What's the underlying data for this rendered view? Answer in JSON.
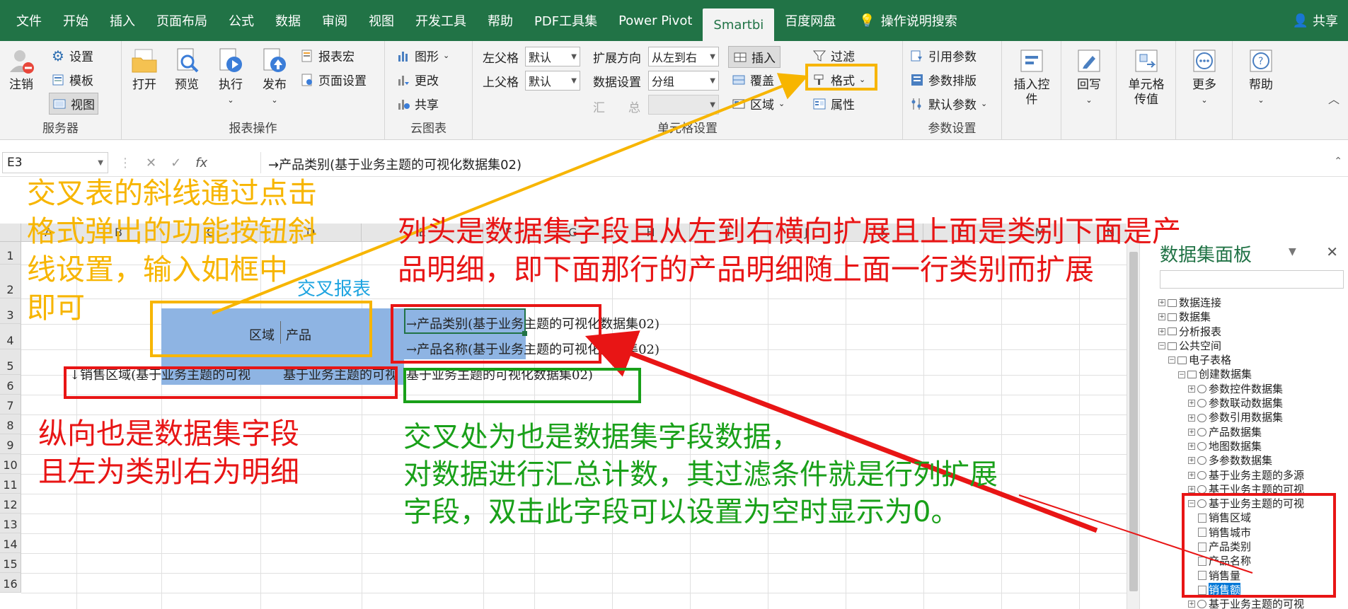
{
  "menu": {
    "tabs": [
      "文件",
      "开始",
      "插入",
      "页面布局",
      "公式",
      "数据",
      "审阅",
      "视图",
      "开发工具",
      "帮助",
      "PDF工具集",
      "Power Pivot",
      "Smartbi",
      "百度网盘"
    ],
    "active_tab": "Smartbi",
    "tell_me": "操作说明搜索",
    "share": "共享"
  },
  "ribbon": {
    "server": {
      "logout": "注销",
      "settings": "设置",
      "template": "模板",
      "view": "视图",
      "label": "服务器"
    },
    "report_ops": {
      "open": "打开",
      "preview": "预览",
      "execute": "执行",
      "publish": "发布",
      "macro": "报表宏",
      "page_setup": "页面设置",
      "label": "报表操作"
    },
    "cloud_chart": {
      "chart": "图形",
      "change": "更改",
      "share": "共享",
      "label": "云图表"
    },
    "cell_settings": {
      "left_parent": "左父格",
      "left_parent_value": "默认",
      "top_parent": "上父格",
      "top_parent_value": "默认",
      "expand_dir": "扩展方向",
      "expand_dir_value": "从左到右",
      "data_setting": "数据设置",
      "data_setting_value": "分组",
      "summary": "汇",
      "total": "总",
      "insert": "插入",
      "cover": "覆盖",
      "region": "区域",
      "filter": "过滤",
      "format": "格式",
      "attribute": "属性",
      "label": "单元格设置"
    },
    "params": {
      "ref_param": "引用参数",
      "param_layout": "参数排版",
      "default_param": "默认参数",
      "label": "参数设置"
    },
    "insert_ctrl": "插入控件",
    "writeback": "回写",
    "cell_pass": "单元格传值",
    "more": "更多",
    "help": "帮助"
  },
  "formula_bar": {
    "name_box": "E3",
    "formula": "→产品类别(基于业务主题的可视化数据集02)"
  },
  "sheet": {
    "columns": [
      "A",
      "B",
      "C",
      "D",
      "E",
      "F",
      "G",
      "H",
      "I",
      "J",
      "K",
      "L",
      "M",
      "N"
    ],
    "rows": [
      "1",
      "2",
      "3",
      "4",
      "5",
      "6",
      "7",
      "8",
      "9",
      "10",
      "11",
      "12",
      "13",
      "14",
      "15",
      "16"
    ],
    "title": "交叉报表",
    "corner_left": "区域",
    "corner_right": "产品",
    "e3": "→产品类别(基于业务主题的可视化数据集02)",
    "e4": "→产品名称(基于业务主题的可视化数据集02)",
    "b5": "↓销售区域(基于业务主题的可视",
    "c5": "基于业务主题的可视",
    "e5": "基于业务主题的可视化数据集02)"
  },
  "panel": {
    "title": "数据集面板",
    "tree": [
      {
        "level": 0,
        "label": "数据连接"
      },
      {
        "level": 0,
        "label": "数据集"
      },
      {
        "level": 0,
        "label": "分析报表"
      },
      {
        "level": 0,
        "label": "公共空间"
      },
      {
        "level": 1,
        "label": "电子表格"
      },
      {
        "level": 2,
        "label": "创建数据集"
      },
      {
        "level": 3,
        "label": "参数控件数据集"
      },
      {
        "level": 3,
        "label": "参数联动数据集"
      },
      {
        "level": 3,
        "label": "参数引用数据集"
      },
      {
        "level": 3,
        "label": "产品数据集"
      },
      {
        "level": 3,
        "label": "地图数据集"
      },
      {
        "level": 3,
        "label": "多参数数据集"
      },
      {
        "level": 3,
        "label": "基于业务主题的多源"
      },
      {
        "level": 3,
        "label": "基于业务主题的可视"
      },
      {
        "level": 3,
        "label": "基于业务主题的可视"
      },
      {
        "level": 4,
        "label": "销售区域"
      },
      {
        "level": 4,
        "label": "销售城市"
      },
      {
        "level": 4,
        "label": "产品类别"
      },
      {
        "level": 4,
        "label": "产品名称"
      },
      {
        "level": 4,
        "label": "销售量"
      },
      {
        "level": 4,
        "label": "销售额"
      },
      {
        "level": 3,
        "label": "基于业务主题的可视"
      }
    ]
  },
  "annotations": {
    "yellow": [
      "交叉表的斜线通过点击",
      "格式弹出的功能按钮斜",
      "线设置，输入如框中",
      "即可"
    ],
    "red_top": [
      "列头是数据集字段且从左到右横向扩展且上面是类别下面是产",
      "品明细，即下面那行的产品明细随上面一行类别而扩展"
    ],
    "red_left": [
      "纵向也是数据集字段",
      "且左为类别右为明细"
    ],
    "green": [
      "交叉处为也是数据集字段数据，",
      "对数据进行汇总计数，其过滤条件就是行列扩展",
      "字段，双击此字段可以设置为空时显示为0。"
    ]
  },
  "colors": {
    "excel_green": "#217346",
    "annot_yellow": "#f7b500",
    "annot_red": "#e81515",
    "annot_green": "#19a019",
    "cell_blue": "#8eb4e3",
    "title_blue": "#1ea4e0"
  }
}
